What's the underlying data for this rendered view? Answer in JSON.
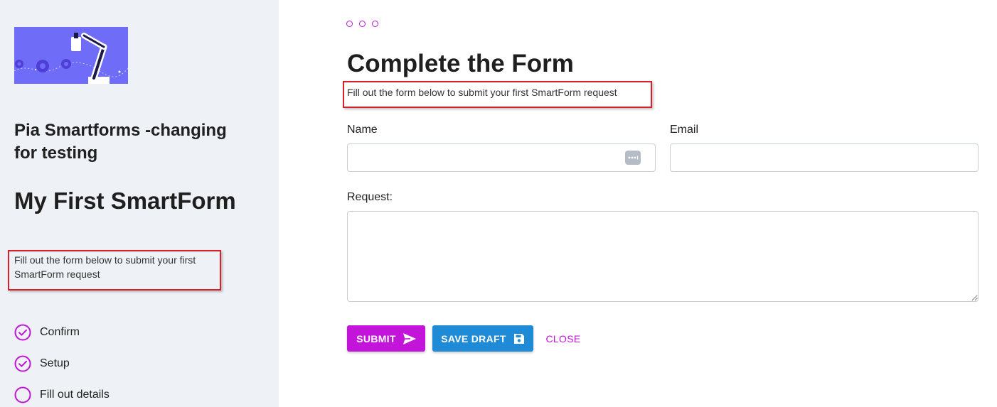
{
  "sidebar": {
    "app_title": "Pia Smartforms -changing for testing",
    "form_title": "My First SmartForm",
    "description": "Fill out the form below to submit your first SmartForm request",
    "steps": [
      {
        "label": "Confirm",
        "status": "completed",
        "icon": "check-circle-icon"
      },
      {
        "label": "Setup",
        "status": "completed",
        "icon": "check-circle-icon"
      },
      {
        "label": "Fill out details",
        "status": "current",
        "icon": "empty-circle-icon"
      }
    ]
  },
  "main": {
    "title": "Complete the Form",
    "description": "Fill out the form below to submit your first SmartForm request",
    "fields": {
      "name": {
        "label": "Name",
        "value": "",
        "placeholder": ""
      },
      "email": {
        "label": "Email",
        "value": "",
        "placeholder": ""
      },
      "request": {
        "label": "Request:",
        "value": "",
        "placeholder": ""
      }
    },
    "buttons": {
      "submit": "SUBMIT",
      "save_draft": "SAVE DRAFT",
      "close": "CLOSE"
    }
  },
  "colors": {
    "accent": "#c314d9",
    "primary_blue": "#1f8ad6",
    "sidebar_bg": "#eef2f6",
    "logo_bg": "#6f6cf7",
    "highlight_border": "#d9202a"
  }
}
